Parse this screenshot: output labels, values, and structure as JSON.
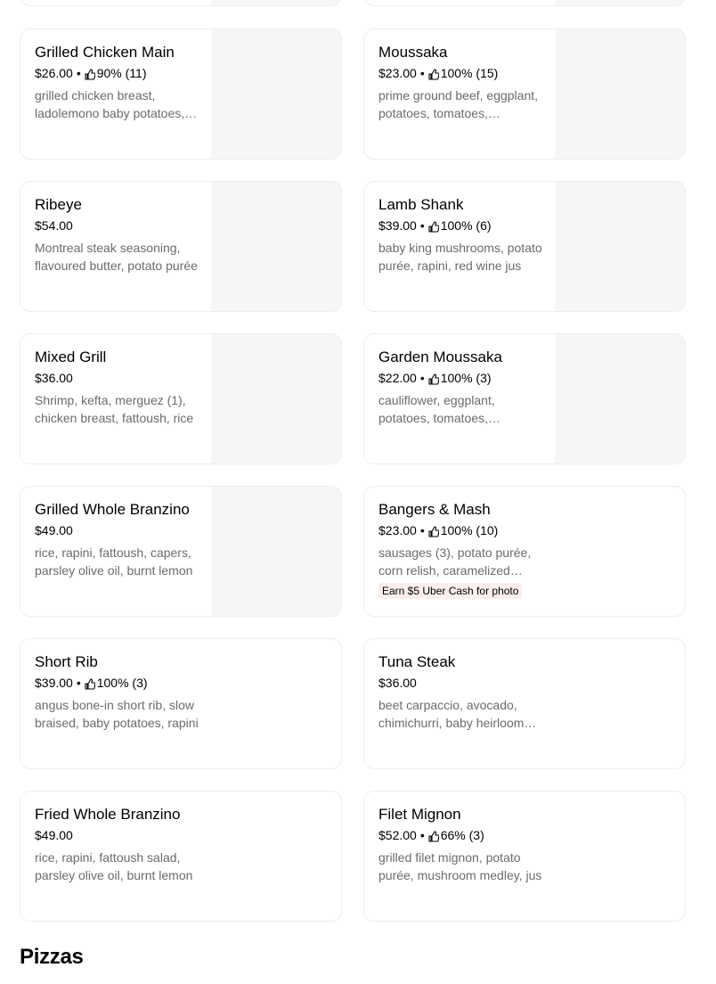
{
  "menu": {
    "items": [
      {
        "name": "Grilled Chicken Main",
        "price": "$26.00",
        "rating": "90% (11)",
        "description": "grilled chicken breast, ladolemono baby potatoes, fattoush salad",
        "has_image": true
      },
      {
        "name": "Moussaka",
        "price": "$23.00",
        "rating": "100% (15)",
        "description": "prime ground beef, eggplant, potatoes, tomatoes, béchamel",
        "has_image": true
      },
      {
        "name": "Ribeye",
        "price": "$54.00",
        "rating": "",
        "description": "Montreal steak seasoning, flavoured butter, potato purée",
        "has_image": true
      },
      {
        "name": "Lamb Shank",
        "price": "$39.00",
        "rating": "100% (6)",
        "description": "baby king mushrooms, potato purée, rapini, red wine jus",
        "has_image": true
      },
      {
        "name": "Mixed Grill",
        "price": "$36.00",
        "rating": "",
        "description": "Shrimp, kefta, merguez (1), chicken breast, fattoush, rice",
        "has_image": true
      },
      {
        "name": "Garden Moussaka",
        "price": "$22.00",
        "rating": "100% (3)",
        "description": "cauliflower, eggplant, potatoes, tomatoes, béchamel",
        "has_image": true
      },
      {
        "name": "Grilled Whole Branzino",
        "price": "$49.00",
        "rating": "",
        "description": "rice, rapini, fattoush, capers, parsley olive oil, burnt lemon",
        "has_image": true
      },
      {
        "name": "Bangers & Mash",
        "price": "$23.00",
        "rating": "100% (10)",
        "description": "sausages (3), potato purée, corn relish, caramelized onions",
        "promo": "Earn $5 Uber Cash for photo",
        "has_image": false
      },
      {
        "name": "Short Rib",
        "price": "$39.00",
        "rating": "100% (3)",
        "description": "angus bone-in short rib, slow braised, baby potatoes, rapini",
        "has_image": false
      },
      {
        "name": "Tuna Steak",
        "price": "$36.00",
        "rating": "",
        "description": "beet carpaccio, avocado, chimichurri, baby heirloom tomatoes",
        "has_image": false
      },
      {
        "name": "Fried Whole Branzino",
        "price": "$49.00",
        "rating": "",
        "description": "rice, rapini, fattoush salad, parsley olive oil, burnt lemon",
        "has_image": false
      },
      {
        "name": "Filet Mignon",
        "price": "$52.00",
        "rating": "66% (3)",
        "description": "grilled filet mignon, potato purée, mushroom medley, jus",
        "has_image": false
      }
    ],
    "separator": "•",
    "thumb_icon": "thumbs-up-icon"
  },
  "sections": {
    "next_title": "Pizzas"
  }
}
